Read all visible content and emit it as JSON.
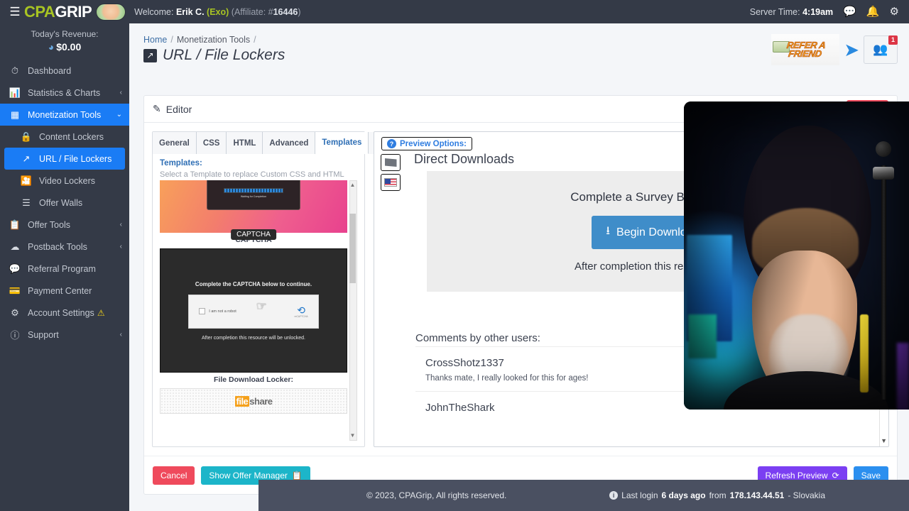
{
  "topbar": {
    "menu_icon": "hamburger-icon",
    "logo_cpa": "CPA",
    "logo_grip": "GRIP",
    "welcome_label": "Welcome:",
    "user_name": "Erik C.",
    "user_alias": "(Exo)",
    "affiliate_prefix": "(Affiliate: #",
    "affiliate_id": "16446",
    "affiliate_suffix": ")",
    "server_time_label": "Server Time:",
    "server_time": "4:19am",
    "icons": [
      "chat-icon",
      "bell-icon",
      "gear-icon"
    ]
  },
  "sidebar": {
    "revenue_label": "Today's Revenue:",
    "revenue_value": "$0.00",
    "items": [
      {
        "label": "Dashboard",
        "icon": "dashboard-icon",
        "caret": "",
        "active": false
      },
      {
        "label": "Statistics & Charts",
        "icon": "chart-icon",
        "caret": "‹",
        "active": false
      },
      {
        "label": "Monetization Tools",
        "icon": "grid-icon",
        "caret": "⌄",
        "active": true
      },
      {
        "label": "Content Lockers",
        "icon": "lock-icon",
        "caret": "",
        "sub": true
      },
      {
        "label": "URL / File Lockers",
        "icon": "link-icon",
        "caret": "",
        "sub": true,
        "active": true
      },
      {
        "label": "Video Lockers",
        "icon": "video-icon",
        "caret": "",
        "sub": true
      },
      {
        "label": "Offer Walls",
        "icon": "wall-icon",
        "caret": "",
        "sub": true
      },
      {
        "label": "Offer Tools",
        "icon": "clipboard-icon",
        "caret": "‹"
      },
      {
        "label": "Postback Tools",
        "icon": "cloud-icon",
        "caret": "‹"
      },
      {
        "label": "Referral Program",
        "icon": "referral-icon",
        "caret": ""
      },
      {
        "label": "Payment Center",
        "icon": "card-icon",
        "caret": ""
      },
      {
        "label": "Account Settings",
        "icon": "gear-icon",
        "caret": "",
        "warning": "⚠"
      },
      {
        "label": "Support",
        "icon": "info-icon",
        "caret": "‹"
      }
    ]
  },
  "breadcrumb": {
    "home": "Home",
    "section": "Monetization Tools",
    "separator": "/"
  },
  "page": {
    "title": "URL / File Lockers",
    "title_icon": "link-arrow-icon"
  },
  "refer": {
    "line1": "REFER A",
    "line2": "FRIEND",
    "arrow": "➤",
    "people_icon": "people-icon",
    "badge_count": "1"
  },
  "editor": {
    "header_title": "Editor",
    "header_icon": "pencil-square-icon",
    "cancel_top": "Cancel",
    "tabs": [
      {
        "label": "General",
        "active": false
      },
      {
        "label": "CSS",
        "active": false
      },
      {
        "label": "HTML",
        "active": false
      },
      {
        "label": "Advanced",
        "active": false
      },
      {
        "label": "Templates",
        "active": true
      }
    ],
    "templates_heading": "Templates:",
    "templates_sub": "Select a Template to replace Custom CSS and HTML Tweaks and modify as needed.",
    "thumbs": [
      {
        "name": "progress-bar-template",
        "caption": "CAPTCHA",
        "tooltip": "CAPTCHA",
        "inner_text": "Waiting for Completion"
      },
      {
        "name": "captcha-template",
        "caption": "File Download Locker:",
        "head": "Complete the CAPTCHA below to continue.",
        "checkbox_label": "I am not a robot",
        "recaptcha_label": "reCAPTCHA",
        "foot": "After completion this resource will be unlocked."
      },
      {
        "name": "fileshare-template",
        "logo_a": "file",
        "logo_b": "share"
      }
    ],
    "footer_cancel": "Cancel",
    "footer_offer_manager": "Show Offer Manager",
    "footer_offer_manager_icon": "clipboard-icon",
    "footer_refresh": "Refresh Preview",
    "footer_refresh_icon": "refresh-icon",
    "footer_save": "Save"
  },
  "preview": {
    "options_label": "Preview Options:",
    "options_icon": "question-circle-icon",
    "flag_buttons": [
      "grey-flag-icon",
      "us-flag-icon"
    ],
    "title": "Direct Downloads",
    "panel_heading": "Complete a Survey Below to C",
    "download_button": "Begin Download",
    "download_icon": "download-icon",
    "panel_footer": "After completion this resource wil",
    "comments_title": "Comments by other users:",
    "comments": [
      {
        "user": "CrossShotz1337",
        "text": "Thanks mate, I really looked for this for ages!"
      },
      {
        "user": "JohnTheShark",
        "text": ""
      }
    ],
    "scroll_down_icon": "chevron-down-icon"
  },
  "footer": {
    "copyright": "© 2023, CPAGrip, All rights reserved.",
    "login_icon": "info-icon",
    "login_prefix": "Last login",
    "login_when": "6 days ago",
    "login_from": "from",
    "login_ip": "178.143.44.51",
    "login_country": "- Slovakia"
  }
}
